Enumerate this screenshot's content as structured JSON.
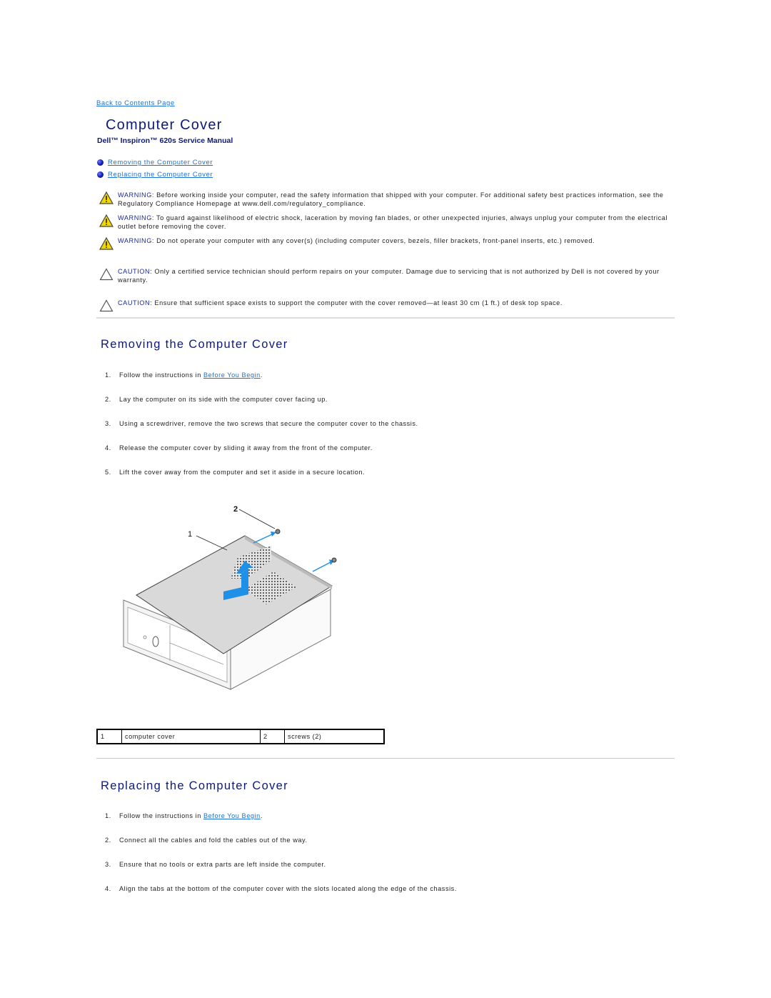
{
  "nav": {
    "back_link": "Back to Contents Page"
  },
  "header": {
    "title": "Computer Cover",
    "subtitle": "Dell™ Inspiron™ 620s Service Manual"
  },
  "toc": [
    {
      "label": "Removing the Computer Cover"
    },
    {
      "label": "Replacing the Computer Cover"
    }
  ],
  "notes": [
    {
      "type": "warning",
      "label": "WARNING:",
      "text": " Before working inside your computer, read the safety information that shipped with your computer. For additional safety best practices information, see the Regulatory Compliance Homepage at www.dell.com/regulatory_compliance."
    },
    {
      "type": "warning",
      "label": "WARNING:",
      "text": " To guard against likelihood of electric shock, laceration by moving fan blades, or other unexpected injuries, always unplug your computer from the electrical outlet before removing the cover."
    },
    {
      "type": "warning",
      "label": "WARNING:",
      "text": " Do not operate your computer with any cover(s) (including computer covers, bezels, filler brackets, front-panel inserts, etc.) removed."
    },
    {
      "type": "caution",
      "label": "CAUTION:",
      "text": " Only a certified service technician should perform repairs on your computer. Damage due to servicing that is not authorized by Dell is not covered by your warranty."
    },
    {
      "type": "caution",
      "label": "CAUTION:",
      "text": " Ensure that sufficient space exists to support the computer with the cover removed—at least 30 cm (1 ft.) of desk top space."
    }
  ],
  "removing": {
    "title": "Removing the Computer Cover",
    "steps": [
      {
        "num": "1.",
        "pre": "Follow the instructions in ",
        "link": "Before You Begin",
        "post": "."
      },
      {
        "num": "2.",
        "pre": "Lay the computer on its side with the computer cover facing up."
      },
      {
        "num": "3.",
        "pre": "Using a screwdriver, remove the two screws that secure the computer cover to the chassis."
      },
      {
        "num": "4.",
        "pre": "Release the computer cover by sliding it away from the front of the computer."
      },
      {
        "num": "5.",
        "pre": "Lift the cover away from the computer and set it aside in a secure location."
      }
    ],
    "figure": {
      "callouts": [
        "1",
        "2"
      ]
    },
    "legend": [
      {
        "num": "1",
        "label": "computer cover"
      },
      {
        "num": "2",
        "label": "screws (2)"
      }
    ]
  },
  "replacing": {
    "title": "Replacing the Computer Cover",
    "steps": [
      {
        "num": "1.",
        "pre": "Follow the instructions in ",
        "link": "Before You Begin",
        "post": "."
      },
      {
        "num": "2.",
        "pre": "Connect all the cables and fold the cables out of the way."
      },
      {
        "num": "3.",
        "pre": "Ensure that no tools or extra parts are left inside the computer."
      },
      {
        "num": "4.",
        "pre": "Align the tabs at the bottom of the computer cover with the slots located along the edge of the chassis."
      }
    ]
  },
  "colors": {
    "heading": "#0d1a7a",
    "link": "#1e6fd0",
    "warning_icon": "#f2d600",
    "arrow": "#1e90e8"
  }
}
